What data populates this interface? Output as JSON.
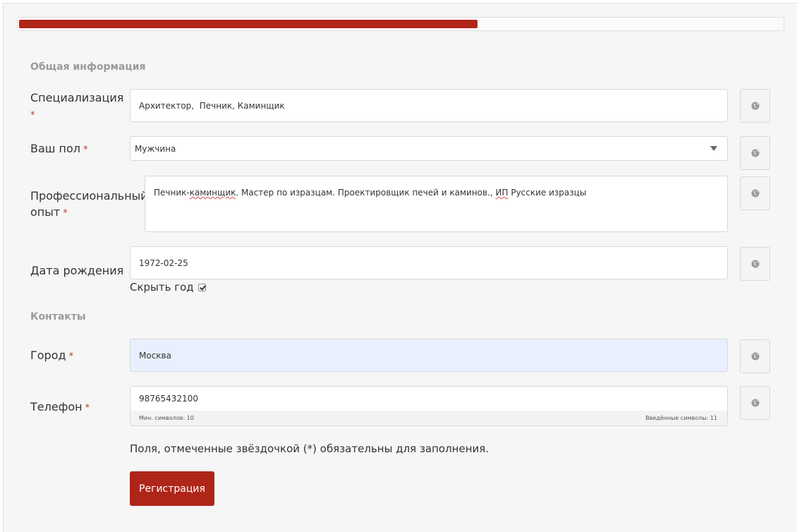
{
  "progress": {
    "percent": 60
  },
  "sections": {
    "general": "Общая информация",
    "contacts": "Контакты"
  },
  "fields": {
    "specialization": {
      "label": "Специализация",
      "required": "*",
      "value": "Архитектор,  Печник, Каминщик"
    },
    "gender": {
      "label": "Ваш пол",
      "required": "*",
      "value": "Мужчина"
    },
    "experience": {
      "label_line1": "Профессиональный",
      "label_line2": "опыт",
      "required": "*",
      "value_part1": "Печник-",
      "value_spell1": "каминщик",
      "value_part2": ". Мастер по изразцам. Проектировщик печей и каминов., ",
      "value_spell2": "ИП",
      "value_part3": " Русские изразцы"
    },
    "birthdate": {
      "label": "Дата рождения",
      "value": "1972-02-25",
      "hide_year_label": "Скрыть год",
      "hide_year_checked": true
    },
    "city": {
      "label": "Город",
      "required": "*",
      "value": "Москва"
    },
    "phone": {
      "label": "Телефон",
      "required": "*",
      "value": "98765432100",
      "min_chars": "Мин. символов: 10",
      "entered_chars": "Введённые символы: 11"
    }
  },
  "footnote": "Поля, отмеченные звёздочкой (*) обязательны для заполнения.",
  "register_button": "Регистрация",
  "icons": {
    "privacy": "globe-icon",
    "dropdown": "chevron-down-icon"
  },
  "colors": {
    "accent": "#b0251a",
    "autofill": "#e8f0fe",
    "required": "#c0392b"
  }
}
